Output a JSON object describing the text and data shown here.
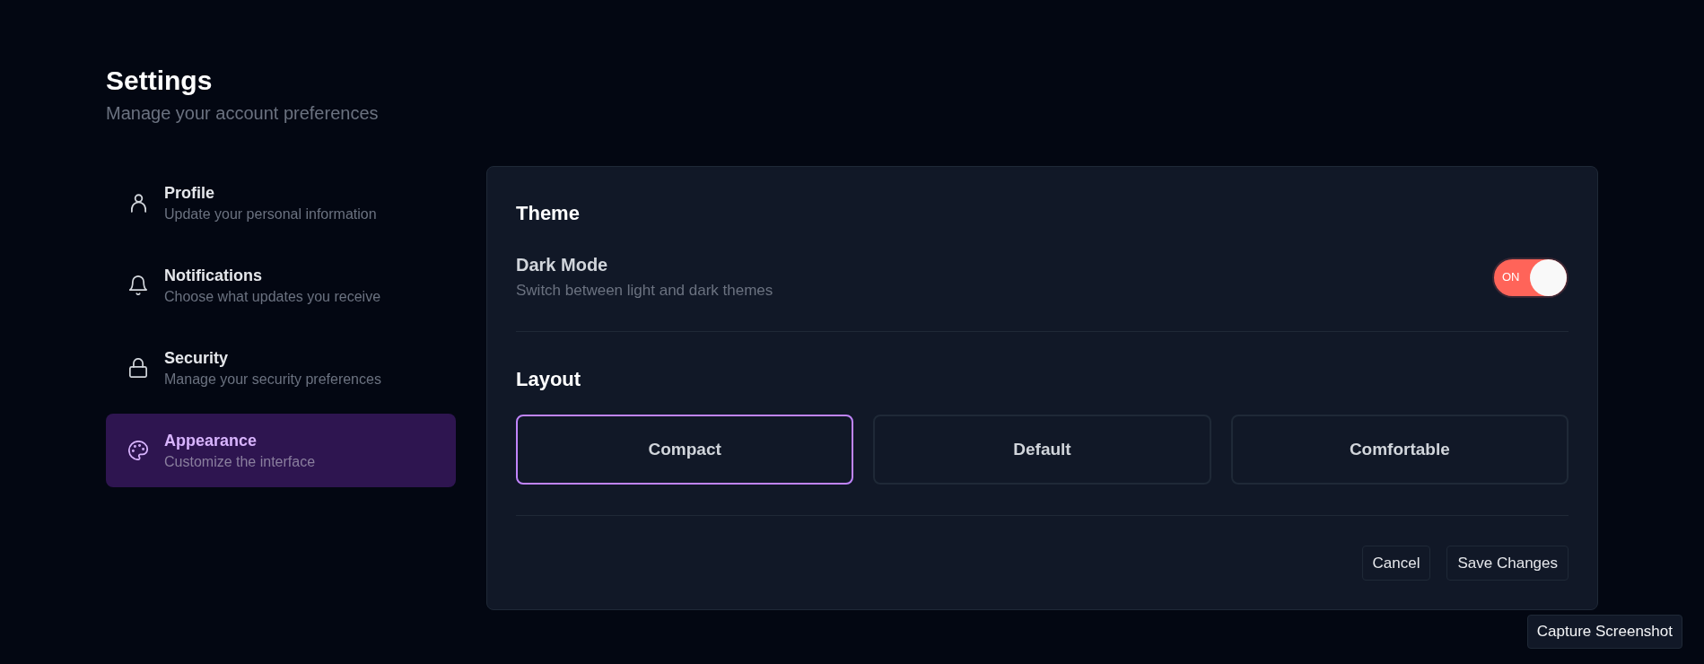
{
  "header": {
    "title": "Settings",
    "subtitle": "Manage your account preferences"
  },
  "sidebar": {
    "items": [
      {
        "title": "Profile",
        "description": "Update your personal information",
        "selected": false
      },
      {
        "title": "Notifications",
        "description": "Choose what updates you receive",
        "selected": false
      },
      {
        "title": "Security",
        "description": "Manage your security preferences",
        "selected": false
      },
      {
        "title": "Appearance",
        "description": "Customize the interface",
        "selected": true
      }
    ]
  },
  "theme": {
    "heading": "Theme",
    "settings": [
      {
        "label": "Dark Mode",
        "description": "Switch between light and dark themes",
        "toggle_label": "ON",
        "on": true
      }
    ]
  },
  "layout": {
    "heading": "Layout",
    "options": [
      {
        "label": "Compact",
        "selected": true
      },
      {
        "label": "Default",
        "selected": false
      },
      {
        "label": "Comfortable",
        "selected": false
      }
    ]
  },
  "actions": [
    {
      "label": "Cancel"
    },
    {
      "label": "Save Changes"
    }
  ],
  "capture_button": {
    "label": "Capture Screenshot"
  }
}
